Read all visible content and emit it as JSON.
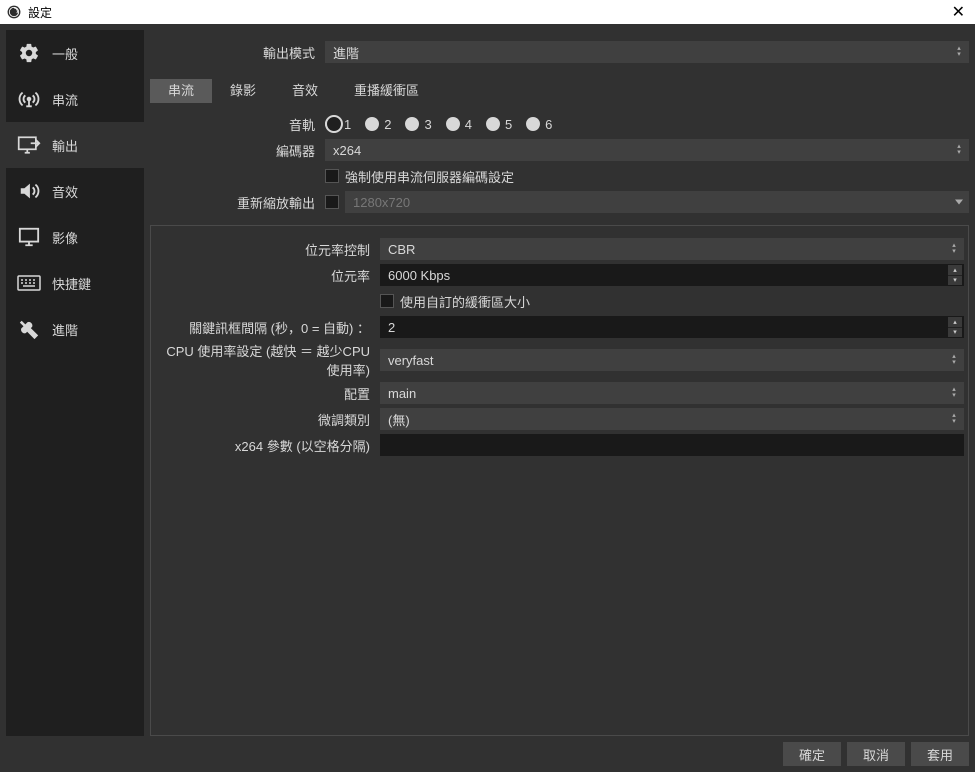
{
  "window": {
    "title": "設定"
  },
  "sidebar": {
    "items": [
      {
        "label": "一般"
      },
      {
        "label": "串流"
      },
      {
        "label": "輸出"
      },
      {
        "label": "音效"
      },
      {
        "label": "影像"
      },
      {
        "label": "快捷鍵"
      },
      {
        "label": "進階"
      }
    ]
  },
  "output_mode": {
    "label": "輸出模式",
    "value": "進階"
  },
  "tabs": [
    {
      "label": "串流"
    },
    {
      "label": "錄影"
    },
    {
      "label": "音效"
    },
    {
      "label": "重播緩衝區"
    }
  ],
  "form": {
    "audio_track_label": "音軌",
    "audio_tracks": [
      "1",
      "2",
      "3",
      "4",
      "5",
      "6"
    ],
    "encoder_label": "編碼器",
    "encoder_value": "x264",
    "enforce_cb_label": "強制使用串流伺服器編碼設定",
    "rescale_label": "重新縮放輸出",
    "rescale_value": "1280x720",
    "rate_control_label": "位元率控制",
    "rate_control_value": "CBR",
    "bitrate_label": "位元率",
    "bitrate_value": "6000 Kbps",
    "custom_buffer_label": "使用自訂的緩衝區大小",
    "keyframe_label": "關鍵訊框間隔 (秒，0 = 自動) ：",
    "keyframe_value": "2",
    "cpu_preset_label": "CPU 使用率設定 (越快 ＝ 越少CPU使用率)",
    "cpu_preset_value": "veryfast",
    "profile_label": "配置",
    "profile_value": "main",
    "tune_label": "微調類別",
    "tune_value": "(無)",
    "x264opts_label": "x264 參數 (以空格分隔)",
    "x264opts_value": ""
  },
  "footer": {
    "ok": "確定",
    "cancel": "取消",
    "apply": "套用"
  }
}
